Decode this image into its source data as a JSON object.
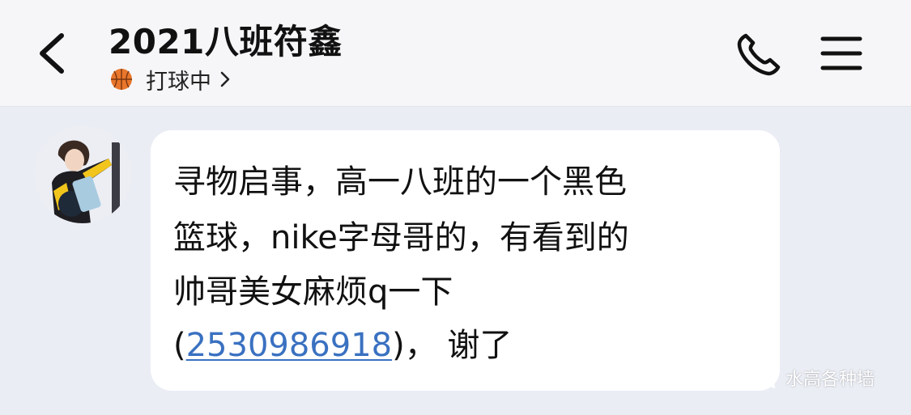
{
  "header": {
    "title": "2021八班符鑫",
    "status_label": "打球中",
    "status_icon": "basketball-icon",
    "back_icon": "back-arrow-icon",
    "call_icon": "phone-icon",
    "menu_icon": "hamburger-menu-icon"
  },
  "message": {
    "line1": "寻物启事，高一八班的一个黑色",
    "line2": "篮球，nike字母哥的，有看到的",
    "line3": "帅哥美女麻烦q一下",
    "line4_prefix": "(",
    "qq_number": "2530986918",
    "line4_suffix": ")，  谢了",
    "link_color": "#3a71c1"
  },
  "watermark": {
    "text": "水高各种墙"
  },
  "colors": {
    "background": "#ebedf5",
    "header_bg": "#f6f6f8",
    "bubble_bg": "#ffffff",
    "basketball": "#e8762b"
  }
}
